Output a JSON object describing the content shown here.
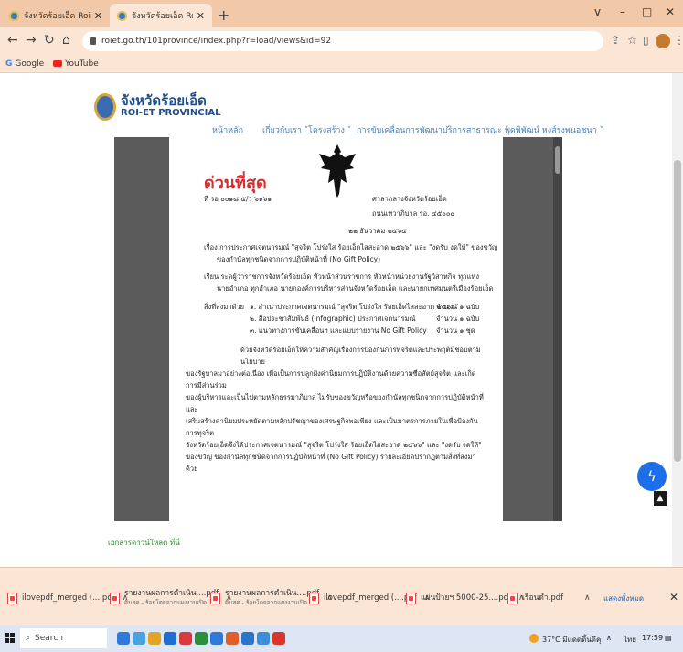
{
  "browser": {
    "tabs": [
      {
        "title": "จังหวัดร้อยเอ็ด Roi-Et Provincial",
        "active": false
      },
      {
        "title": "จังหวัดร้อยเอ็ด Roi-Et Provincial",
        "active": true
      }
    ],
    "new_tab": "+",
    "window_controls": [
      "v",
      "–",
      "□",
      "✕"
    ],
    "url": "roiet.go.th/101province/index.php?r=load/views&id=92",
    "bookmarks": [
      {
        "label": "Google",
        "icon": "google-icon"
      },
      {
        "label": "YouTube",
        "icon": "youtube-icon"
      }
    ]
  },
  "site": {
    "name_th": "จังหวัดร้อยเอ็ด",
    "name_en": "ROI-ET PROVINCIAL",
    "menu": [
      {
        "label": "หน้าหลัก"
      },
      {
        "label": "เกี่ยวกับเรา ˅"
      },
      {
        "label": "โครงสร้าง ˅"
      },
      {
        "label": "การขับเคลื่อนการพัฒนา ˅"
      },
      {
        "label": "บริการสาธารณะ ˅"
      },
      {
        "label": "พุดพิพัฒน์ หงส์รุ่งพนอชนา ˅"
      }
    ]
  },
  "document": {
    "urgency": "ด่วนที่สุด",
    "ref_no": "ที่ รอ ๐๐๑๘.๕/ว ๖๑๖๑",
    "office_line1": "ศาลากลางจังหวัดร้อยเอ็ด",
    "office_line2": "ถนนเทวาภิบาล รอ. ๔๕๐๐๐",
    "date": "๒๒ ธันวาคม ๒๕๖๕",
    "subject": "เรื่อง  การประกาศเจตนารมณ์ \"สุจริต โปร่งใส ร้อยเอ็ดไสสะอาด ๒๕๖๖\" และ \"งดรับ งดให้\" ของขวัญ",
    "subject_cont": "ของกำนัลทุกชนิดจากการปฏิบัติหน้าที่ (No Gift Policy)",
    "to": "เรียน  ระดผู้ว่าราชการจังหวัดร้อยเอ็ด หัวหน้าส่วนราชการ หัวหน้าหน่วยงานรัฐวิสาหกิจ ทุกแห่ง",
    "to_cont": "นายอำเภอ ทุกอำเภอ นายกองค์การบริหารส่วนจังหวัดร้อยเอ็ด และนายกเทศมนตรีเมืองร้อยเอ็ด",
    "attachments_label": "สิ่งที่ส่งมาด้วย",
    "attachments": [
      {
        "text": "๑. สำเนาประกาศเจตนารมณ์ \"สุจริต โปร่งใส ร้อยเอ็ดไสสะอาด ๒๕๖๖\"",
        "qty": "จำนวน ๑ ฉบับ"
      },
      {
        "text": "๒. สื่อประชาสัมพันธ์ (Infographic) ประกาศเจตนารมณ์",
        "qty": "จำนวน ๑ ฉบับ"
      },
      {
        "text": "๓. แนวทางการขับเคลื่อนฯ และแบบรายงาน No Gift Policy",
        "qty": "จำนวน ๑ ชุด"
      }
    ],
    "body": [
      "ด้วยจังหวัดร้อยเอ็ดให้ความสำคัญเรื่องการป้องกันการทุจริตและประพฤติมิชอบตามนโยบาย",
      "ของรัฐบาลมาอย่างต่อเนื่อง เพื่อเป็นการปลูกฝังค่านิยมการปฏิบัติงานด้วยความซื่อสัตย์สุจริต และเกิดการมีส่วนร่วม",
      "ของผู้บริหารและเป็นไปตามหลักธรรมาภิบาล ไม่รับของขวัญหรือของกำนัลทุกชนิดจากการปฏิบัติหน้าที่ และ",
      "เสริมสร้างค่านิยมประหยัดตามหลักปรัชญาของเศรษฐกิจพอเพียง และเป็นมาตรการภายในเพื่อป้องกันการทุจริต",
      "จังหวัดร้อยเอ็ดจึงได้ประกาศเจตนารมณ์ \"สุจริต โปร่งใส ร้อยเอ็ดไสสะอาด ๒๕๖๖\" และ \"งดรับ งดให้\"",
      "ของขวัญ ของกำนัลทุกชนิดจากการปฏิบัติหน้าที่ (No Gift Policy) รายละเอียดปรากฏตามสิ่งที่ส่งมาด้วย"
    ]
  },
  "download_link": "เอกสารดาวน์โหลด ที่นี่",
  "downloads": [
    {
      "name": "ilovepdf_merged (....pdf",
      "sub": ""
    },
    {
      "name": "รายงานผลการดำเนิน....pdf",
      "sub": "ดิบสด - ร้อยโดยจากแผงงานเปิด"
    },
    {
      "name": "รายงานผลการดำเนิน....pdf",
      "sub": "ดิบสด - ร้อยโดยจากแผงงานเปิด"
    },
    {
      "name": "ilovepdf_merged (....pdf",
      "sub": ""
    },
    {
      "name": "แผ่นป้ายฯ 5000-25....pdf",
      "sub": ""
    },
    {
      "name": "เรือนดำ.pdf",
      "sub": ""
    }
  ],
  "downloads_show_all": "แสดงทั้งหมด",
  "taskbar": {
    "search_placeholder": "Search",
    "weather": "37°C มีแดดดิ้นดีคุ",
    "lang": "ไทย",
    "time": "17:59",
    "app_colors": [
      "#2f7ad9",
      "#4aa3df",
      "#e0a526",
      "#1e6fd0",
      "#d73a3a",
      "#2c8f3d",
      "#2f7ad9",
      "#e35d2a",
      "#2a74c9",
      "#3a8fd8",
      "#d9352b"
    ]
  }
}
